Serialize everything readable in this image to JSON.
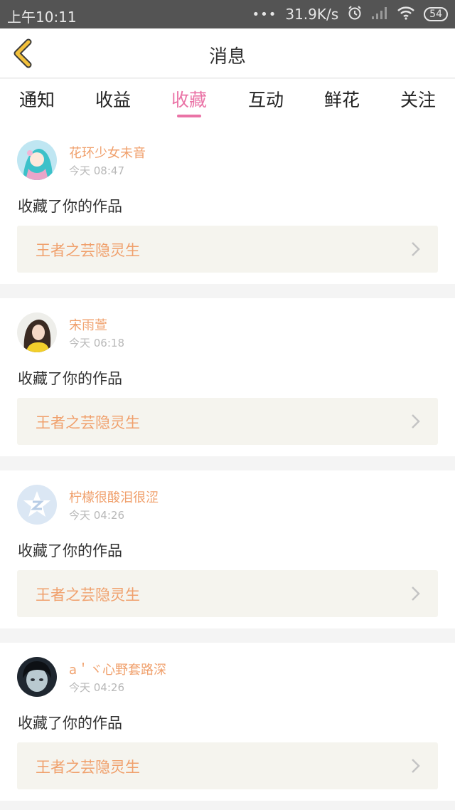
{
  "status": {
    "time": "上午10:11",
    "dots": "•••",
    "speed": "31.9K/s",
    "battery": "54"
  },
  "nav": {
    "title": "消息"
  },
  "tabs": [
    {
      "label": "通知"
    },
    {
      "label": "收益"
    },
    {
      "label": "收藏"
    },
    {
      "label": "互动"
    },
    {
      "label": "鲜花"
    },
    {
      "label": "关注"
    }
  ],
  "active_tab": "收藏",
  "items": [
    {
      "user": "花环少女未音",
      "time": "今天 08:47",
      "action": "收藏了你的作品",
      "work": "王者之芸隐灵生"
    },
    {
      "user": "宋雨萱",
      "time": "今天 06:18",
      "action": "收藏了你的作品",
      "work": "王者之芸隐灵生"
    },
    {
      "user": "柠檬很酸泪很涩",
      "time": "今天 04:26",
      "action": "收藏了你的作品",
      "work": "王者之芸隐灵生"
    },
    {
      "user": "a＇ヾ心野套路深",
      "time": "今天 04:26",
      "action": "收藏了你的作品",
      "work": "王者之芸隐灵生"
    }
  ],
  "colors": {
    "accent": "#ea73a6",
    "name": "#f0a06c",
    "back": "#f3c13b"
  }
}
